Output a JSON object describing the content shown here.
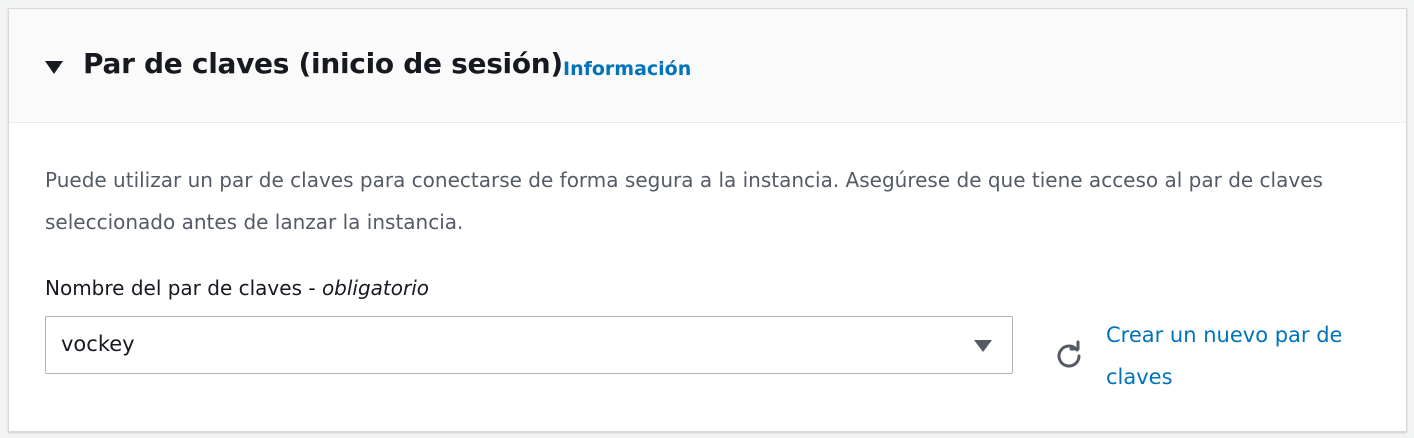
{
  "section": {
    "title": "Par de claves (inicio de sesión)",
    "info_link": "Información",
    "description": "Puede utilizar un par de claves para conectarse de forma segura a la instancia. Asegúrese de que tiene acceso al par de claves seleccionado antes de lanzar la instancia.",
    "expanded": true
  },
  "keypair_field": {
    "label": "Nombre del par de claves - ",
    "label_required": "obligatorio",
    "selected_value": "vockey"
  },
  "actions": {
    "refresh_icon": "refresh-icon",
    "create_link": "Crear un nuevo par de claves"
  },
  "colors": {
    "link": "#0073bb",
    "text": "#16191f",
    "secondary_text": "#545b64",
    "header_bg": "#fafafa",
    "border": "#aab7b8"
  }
}
